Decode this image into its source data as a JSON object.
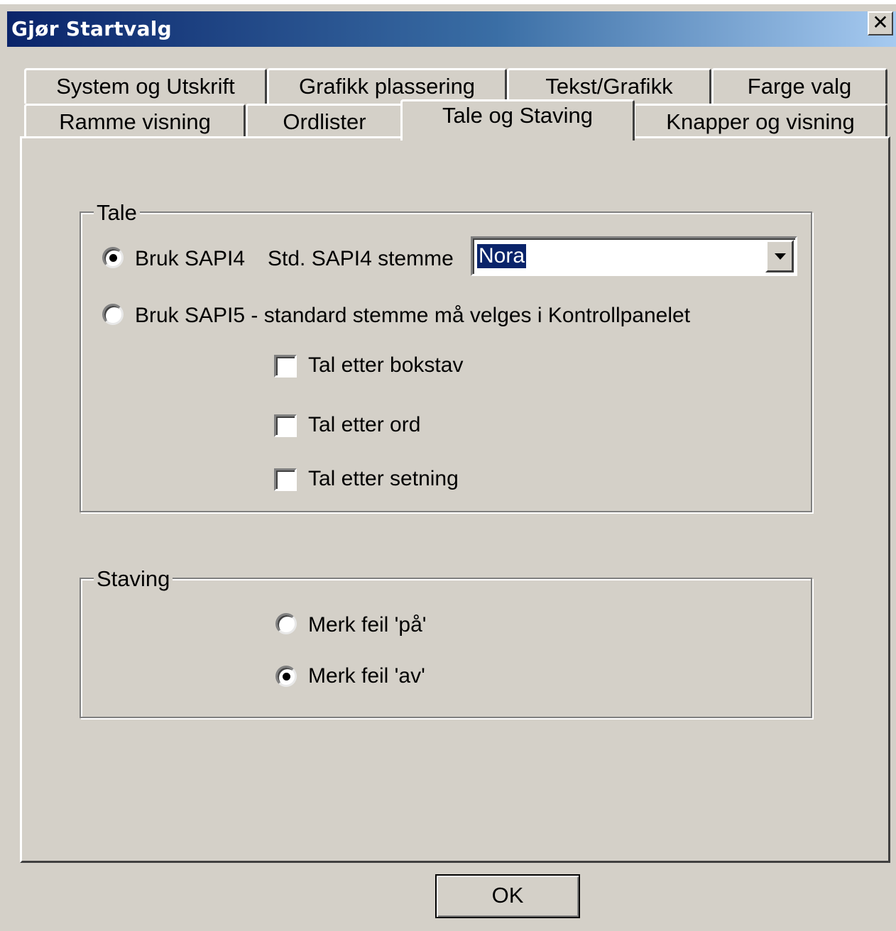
{
  "window": {
    "title": "Gjør Startvalg",
    "close_label": "✕"
  },
  "tabs": {
    "row1": [
      "System og Utskrift",
      "Grafikk plassering",
      "Tekst/Grafikk",
      "Farge valg"
    ],
    "row2": [
      "Ramme visning",
      "Ordlister",
      "Tale og Staving",
      "Knapper og visning"
    ],
    "active": "Tale og Staving"
  },
  "tale": {
    "group_label": "Tale",
    "sapi4_label": "Bruk SAPI4",
    "sapi4_selected": true,
    "std_voice_label": "Std. SAPI4 stemme",
    "voice_value": "Nora",
    "sapi5_label": "Bruk SAPI5 - standard stemme må velges i Kontrollpanelet",
    "sapi5_selected": false,
    "checkboxes": [
      {
        "label": "Tal etter bokstav",
        "checked": false
      },
      {
        "label": "Tal etter ord",
        "checked": false
      },
      {
        "label": "Tal etter setning",
        "checked": false
      }
    ]
  },
  "staving": {
    "group_label": "Staving",
    "on_label": "Merk feil 'på'",
    "on_selected": false,
    "off_label": "Merk feil 'av'",
    "off_selected": true
  },
  "buttons": {
    "ok_label": "OK"
  }
}
